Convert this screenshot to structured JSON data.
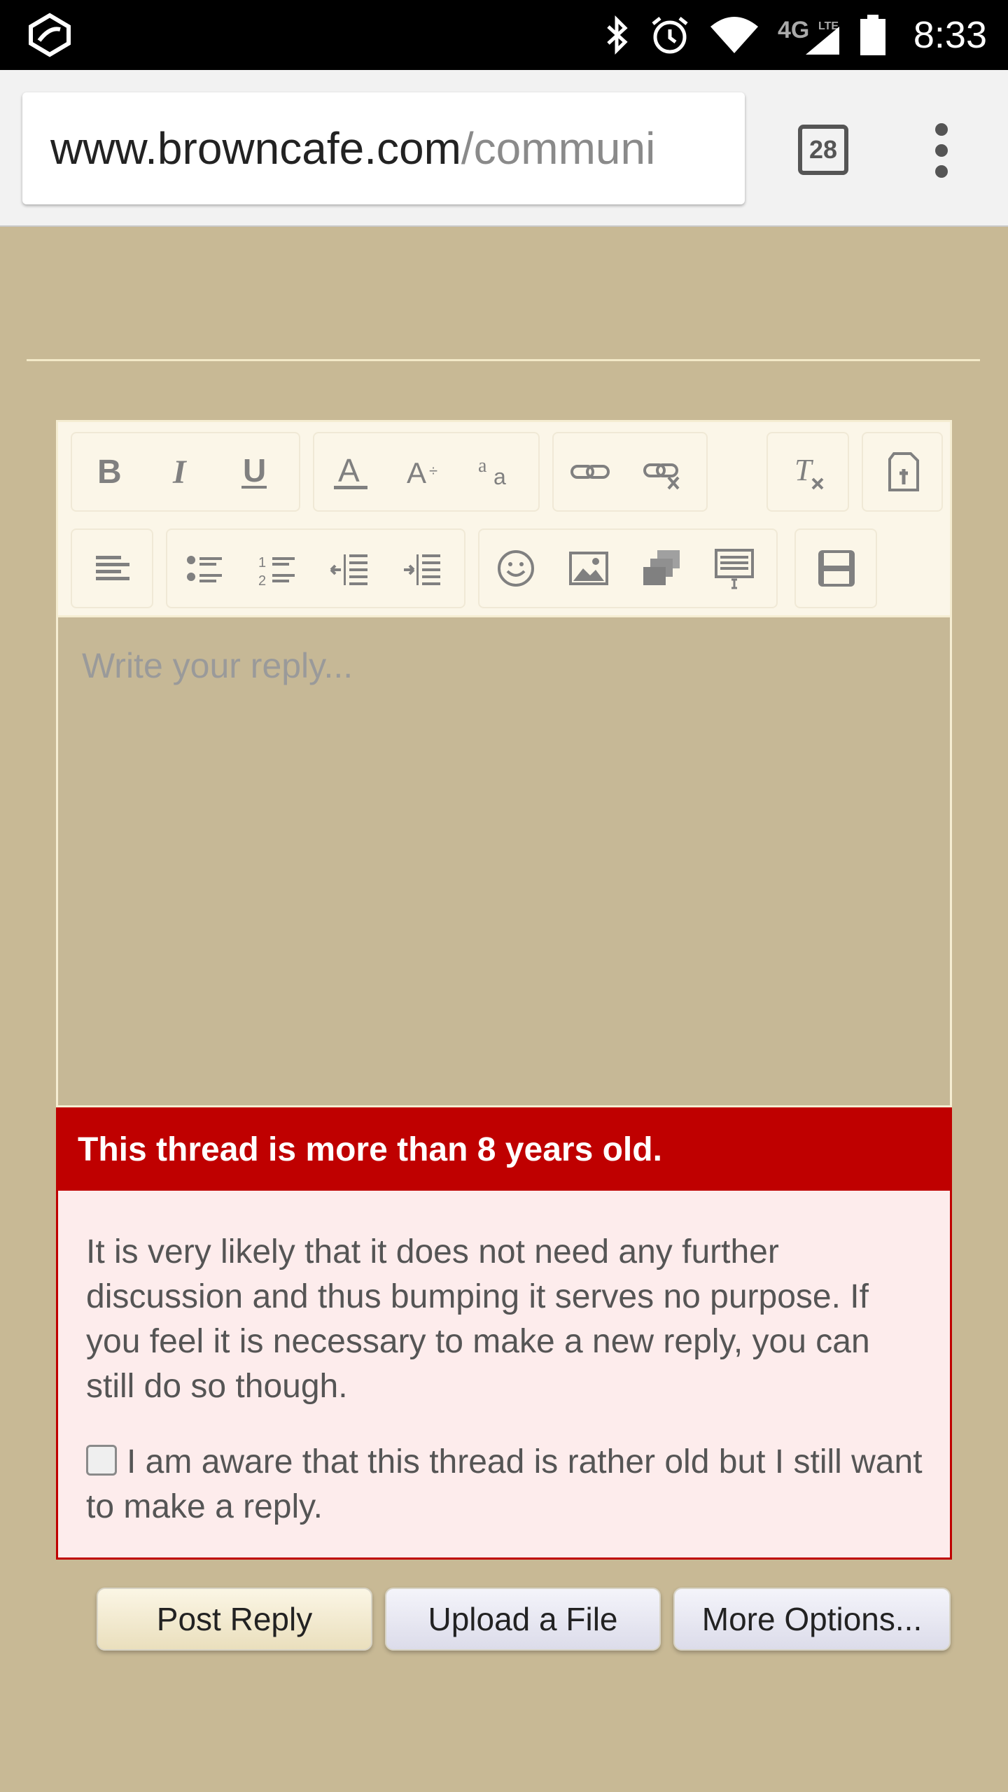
{
  "status_bar": {
    "time": "8:33",
    "network": "4G LTE",
    "icons": [
      "app-icon",
      "bluetooth-icon",
      "alarm-icon",
      "wifi-icon",
      "network-4g-lte-icon",
      "signal-icon",
      "battery-icon"
    ]
  },
  "browser": {
    "url_host": "www.browncafe.com",
    "url_path": "/communi",
    "tab_count": "28"
  },
  "editor": {
    "placeholder": "Write your reply...",
    "toolbar_row1": [
      "bold",
      "italic",
      "underline",
      "font-color",
      "font-size",
      "font-family",
      "link",
      "unlink",
      "remove-format",
      "toggle-bbcode"
    ],
    "toolbar_row2": [
      "align",
      "bulleted-list",
      "numbered-list",
      "outdent",
      "indent",
      "smilies",
      "insert-image",
      "insert-media",
      "insert-code",
      "save-draft"
    ]
  },
  "warning": {
    "title": "This thread is more than 8 years old.",
    "body": "It is very likely that it does not need any further discussion and thus bumping it serves no purpose. If you feel it is necessary to make a new reply, you can still do so though.",
    "checkbox_label": "I am aware that this thread is rather old but I still want to make a reply.",
    "checked": false
  },
  "buttons": {
    "post_reply": "Post Reply",
    "upload_file": "Upload a File",
    "more_options": "More Options..."
  },
  "colors": {
    "page_bg": "#c8b995",
    "warning_red": "#bf0000",
    "toolbar_bg": "#fbf6e8"
  }
}
